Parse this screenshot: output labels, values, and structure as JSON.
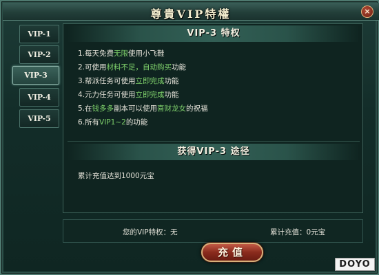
{
  "window": {
    "title": "尊貴VIP特權",
    "close_label": "×"
  },
  "tabs": [
    {
      "label": "VIP-1",
      "active": false
    },
    {
      "label": "VIP-2",
      "active": false
    },
    {
      "label": "VIP-3",
      "active": true
    },
    {
      "label": "VIP-4",
      "active": false
    },
    {
      "label": "VIP-5",
      "active": false
    }
  ],
  "privileges": {
    "header": "VIP-3 特权",
    "items": [
      {
        "prefix": "1.每天免费",
        "highlight": "无限",
        "suffix": "使用小飞鞋"
      },
      {
        "prefix": "2.可使用",
        "highlight": "材料不足，自动购买",
        "suffix": "功能"
      },
      {
        "prefix": "3.帮派任务可使用",
        "highlight": "立即完成",
        "suffix": "功能"
      },
      {
        "prefix": "4.元力任务可使用",
        "highlight": "立即完成",
        "suffix": "功能"
      },
      {
        "prefix": "5.在",
        "highlight": "钱多多",
        "suffix": "副本可以使用",
        "highlight2": "喜财龙女",
        "suffix2": "的祝福"
      },
      {
        "prefix": "6.所有",
        "highlight": "VIP1~2",
        "suffix": "的功能"
      }
    ]
  },
  "acquire": {
    "header": "获得VIP-3 途径",
    "text": "累计充值达到1000元宝"
  },
  "footer": {
    "vip_status": "您的VIP特权：无",
    "total_recharge": "累计充值：0元宝"
  },
  "recharge_button": "充值",
  "watermark": "DOYO",
  "colors": {
    "highlight": "#7fd16b",
    "text": "#e5e3d9",
    "title": "#f4eecf",
    "button": "#8a2b1d"
  }
}
